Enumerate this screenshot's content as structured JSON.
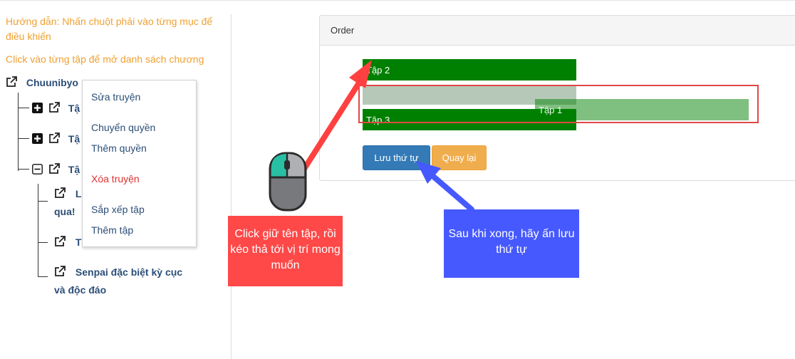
{
  "instructions": {
    "hint_right_click": "Hướng dẫn: Nhấn chuột phải vào từng mục để điều khiển",
    "hint_click_chapter": "Click vào từng tập để mở danh sách chương"
  },
  "tree": {
    "story_label": "Chuunibyo",
    "items": [
      {
        "label": "Tậ"
      },
      {
        "label": "Tậ"
      },
      {
        "label": "Tậ"
      }
    ],
    "subitems": [
      {
        "line1": "Lo",
        "line2": "qua!"
      },
      {
        "line1": "Th"
      },
      {
        "line1": "Senpai đặc biệt kỳ cục",
        "line2": "và độc đáo"
      }
    ]
  },
  "context_menu": {
    "edit_story": "Sửa truyện",
    "transfer_permission": "Chuyển quyền",
    "add_permission": "Thêm quyền",
    "delete_story": "Xóa truyện",
    "sort_chapters": "Sắp xếp tập",
    "add_chapter": "Thêm tập"
  },
  "order_panel": {
    "title": "Order",
    "chapters": [
      {
        "label": "Tập 2"
      },
      {
        "label": "Tập 3"
      }
    ],
    "dragging_chapter": "Tập 1",
    "save_label": "Lưu thứ tự",
    "back_label": "Quay lại"
  },
  "annotations": {
    "drag_tip": "Click giữ tên tập, rồi kéo thả tới vị trí mong muốn",
    "save_tip": "Sau khi xong, hãy ấn lưu thứ tự"
  },
  "colors": {
    "chapter_green": "#008000",
    "hint_orange": "#f0a030",
    "save_blue": "#337ab7",
    "back_orange": "#f0ad4e",
    "annotation_red": "#ff4848",
    "annotation_blue": "#4659ff",
    "delete_red": "#e03030"
  },
  "icons": {
    "external_link": "external-link-icon",
    "expand": "plus-square-icon",
    "collapse": "minus-square-icon",
    "mouse": "mouse-icon"
  }
}
